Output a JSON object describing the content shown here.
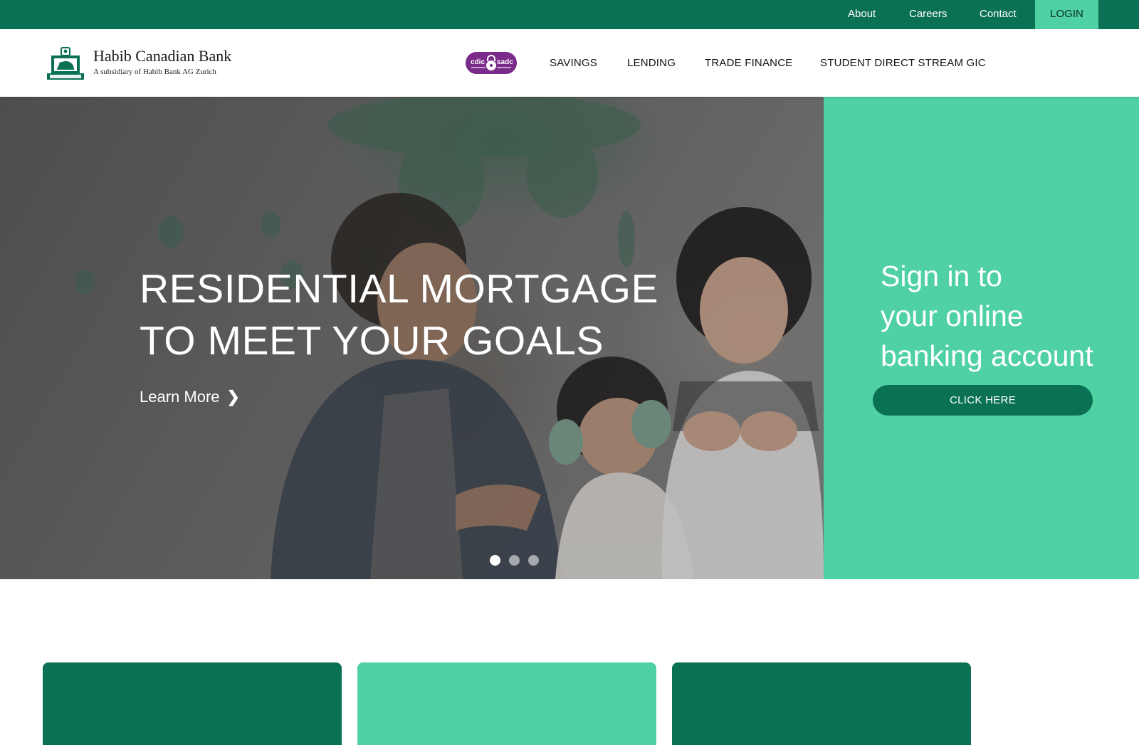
{
  "utility_nav": {
    "about": "About",
    "careers": "Careers",
    "contact": "Contact",
    "login": "LOGIN"
  },
  "brand": {
    "name": "Habib Canadian Bank",
    "tagline": "A subsidiary of Habib Bank AG Zurich",
    "logo_icon": "bank-crest-icon"
  },
  "cdic_badge": {
    "left_text": "cdic",
    "right_text": "sadc",
    "icon": "lock-icon",
    "color": "#7a2b8a"
  },
  "main_nav": [
    "SAVINGS",
    "LENDING",
    "TRADE FINANCE",
    "STUDENT DIRECT STREAM GIC"
  ],
  "hero": {
    "title_line1": "RESIDENTIAL MORTGAGE",
    "title_line2": "TO MEET YOUR GOALS",
    "cta": "Learn More",
    "cta_icon": "chevron-right-icon",
    "slides_total": 3,
    "active_slide": 1
  },
  "signin_panel": {
    "line1": "Sign in to",
    "line2": "your online",
    "line3": "banking account",
    "button": "CLICK HERE"
  },
  "colors": {
    "dark_green": "#0b7155",
    "mint_green": "#4fd1a4",
    "white": "#ffffff"
  }
}
